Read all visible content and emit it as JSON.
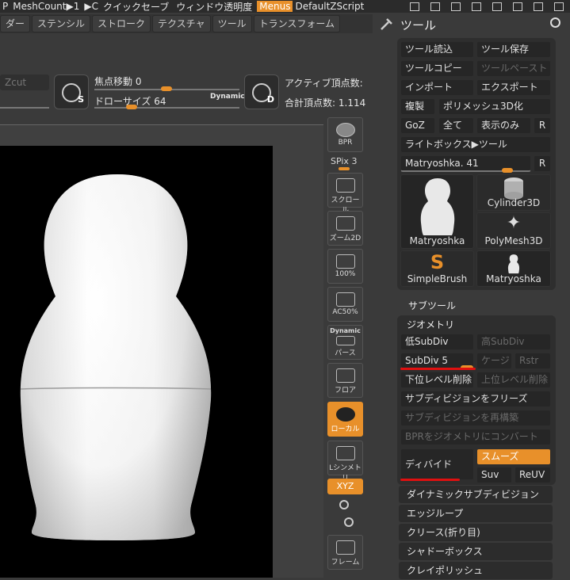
{
  "topbar": {
    "items": [
      "P",
      "MeshCount▶1",
      "▶C",
      "クイックセーブ",
      "ウィンドウ透明度",
      "Menus",
      "DefaultZScript"
    ],
    "transparency_label": "ウィンドウ透明度",
    "menus_label": "Menus"
  },
  "menubar": [
    "ダー",
    "ステンシル",
    "ストローク",
    "テクスチャ",
    "ツール",
    "トランスフォーム"
  ],
  "shelf": {
    "zcut_label": "Zcut",
    "focal_shift_label": "焦点移動",
    "focal_shift_value": "0",
    "draw_size_label": "ドローサイズ",
    "draw_size_value": "64",
    "dynamic_label": "Dynamic",
    "active_points_label": "アクティブ頂点数:",
    "total_points_label": "合計頂点数:",
    "total_points_value": "1.114",
    "s_button_label": "S",
    "d_button_label": "D"
  },
  "right_toolbar": {
    "bpr": "BPR",
    "spix_label": "SPix",
    "spix_value": "3",
    "scroll": "スクロール",
    "zoom2d": "ズーム2D",
    "pct100": "100%",
    "ac50": "AC50%",
    "dynamic": "Dynamic",
    "perspective": "パース",
    "floor": "フロア",
    "local": "ローカル",
    "lsym": "Lシンメトリ",
    "xyz": "XYZ",
    "frame": "フレーム"
  },
  "tool_panel": {
    "title": "ツール",
    "buttons": {
      "load": "ツール読込",
      "save": "ツール保存",
      "copy": "ツールコピー",
      "paste": "ツールペースト",
      "import": "インポート",
      "export": "エクスポート",
      "clone": "複製",
      "polymesh": "ポリメッシュ3D化",
      "goz": "GoZ",
      "all": "全て",
      "visible": "表示のみ",
      "r": "R",
      "lightbox": "ライトボックス▶ツール",
      "current_tool": "Matryoshka. 41",
      "r2": "R"
    },
    "thumbnails": [
      "Matryoshka",
      "Cylinder3D",
      "PolyMesh3D",
      "SimpleBrush",
      "Matryoshka"
    ],
    "subtool_label": "サブツール",
    "geometry_label": "ジオメトリ",
    "geometry": {
      "lower_subdiv": "低SubDiv",
      "higher_subdiv": "高SubDiv",
      "subdiv_label": "SubDiv",
      "subdiv_value": "5",
      "cage": "ケージ",
      "rstr": "Rstr",
      "del_lower": "下位レベル削除",
      "del_higher": "上位レベル削除",
      "freeze": "サブディビジョンをフリーズ",
      "reconstruct": "サブディビジョンを再構築",
      "convert_bpr": "BPRをジオメトリにコンバート",
      "divide": "ディバイド",
      "smooth": "スムーズ",
      "suv": "Suv",
      "reuv": "ReUV"
    },
    "sections": [
      "ダイナミックサブディビジョン",
      "エッジループ",
      "クリース(折り目)",
      "シャドーボックス",
      "クレイポリッシュ"
    ]
  },
  "colors": {
    "accent": "#e8902a",
    "highlight_red": "#e01010"
  }
}
